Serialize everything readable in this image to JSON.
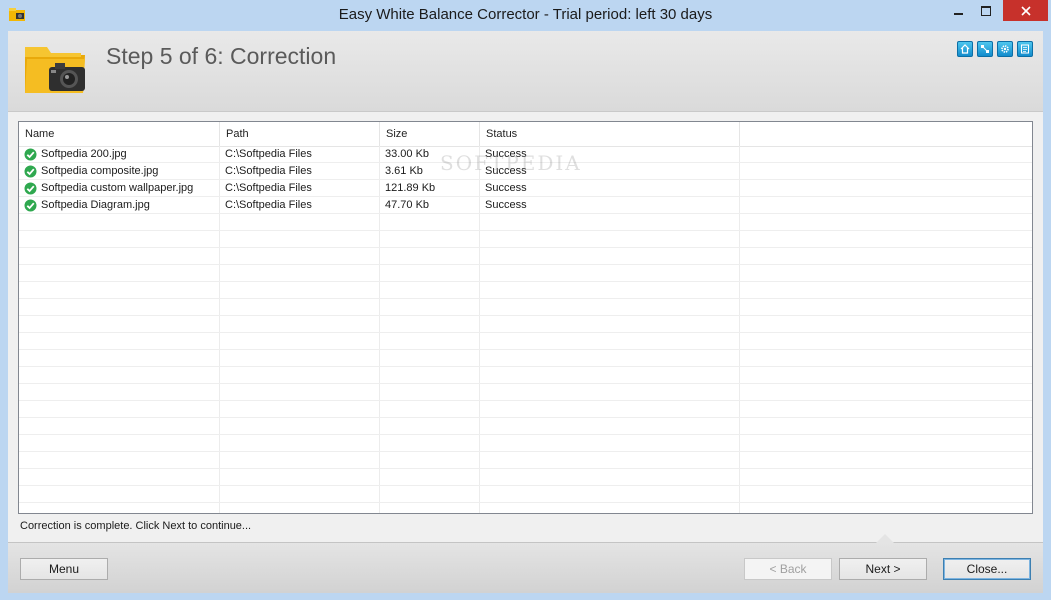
{
  "window": {
    "title": "Easy White Balance Corrector - Trial period: left 30 days"
  },
  "header": {
    "step_title": "Step 5 of 6: Correction",
    "icons": [
      "home-icon",
      "network-icon",
      "settings-icon",
      "register-icon"
    ]
  },
  "list": {
    "columns": [
      "Name",
      "Path",
      "Size",
      "Status"
    ],
    "rows": [
      {
        "name": "Softpedia 200.jpg",
        "path": "C:\\Softpedia Files",
        "size": "33.00 Kb",
        "status": "Success"
      },
      {
        "name": "Softpedia composite.jpg",
        "path": "C:\\Softpedia Files",
        "size": "3.61 Kb",
        "status": "Success"
      },
      {
        "name": "Softpedia custom wallpaper.jpg",
        "path": "C:\\Softpedia Files",
        "size": "121.89 Kb",
        "status": "Success"
      },
      {
        "name": "Softpedia Diagram.jpg",
        "path": "C:\\Softpedia Files",
        "size": "47.70 Kb",
        "status": "Success"
      }
    ]
  },
  "status_message": "Correction is complete. Click Next to continue...",
  "footer": {
    "menu_label": "Menu",
    "back_label": "< Back",
    "next_label": "Next >",
    "close_label": "Close..."
  },
  "watermark": "SOFTPEDIA",
  "colors": {
    "accent": "#1a93d0",
    "success": "#2fa84f",
    "close_button": "#c7312b"
  }
}
